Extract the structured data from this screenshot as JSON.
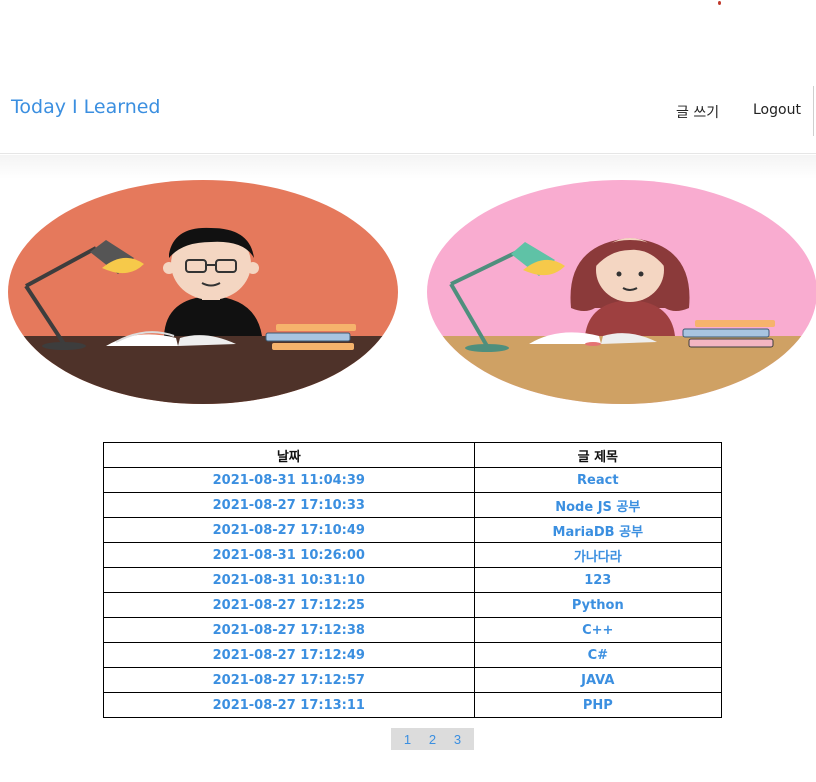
{
  "header": {
    "brand": "Today I Learned",
    "nav": {
      "write": "글 쓰기",
      "logout": "Logout"
    }
  },
  "illustrations": [
    {
      "name": "boy-studying",
      "bg_color": "#e5795c",
      "desk_color": "#4e3229"
    },
    {
      "name": "girl-studying",
      "bg_color": "#f9acd0",
      "desk_color": "#cfa164"
    }
  ],
  "table": {
    "headers": [
      "날짜",
      "글 제목"
    ],
    "rows": [
      {
        "date": "2021-08-31 11:04:39",
        "title": "React"
      },
      {
        "date": "2021-08-27 17:10:33",
        "title": "Node JS 공부"
      },
      {
        "date": "2021-08-27 17:10:49",
        "title": "MariaDB 공부"
      },
      {
        "date": "2021-08-31 10:26:00",
        "title": "가나다라"
      },
      {
        "date": "2021-08-31 10:31:10",
        "title": "123"
      },
      {
        "date": "2021-08-27 17:12:25",
        "title": "Python"
      },
      {
        "date": "2021-08-27 17:12:38",
        "title": "C++"
      },
      {
        "date": "2021-08-27 17:12:49",
        "title": "C#"
      },
      {
        "date": "2021-08-27 17:12:57",
        "title": "JAVA"
      },
      {
        "date": "2021-08-27 17:13:11",
        "title": "PHP"
      }
    ]
  },
  "pagination": [
    "1",
    "2",
    "3"
  ],
  "colors": {
    "link": "#3b8fe0",
    "pagination_bg": "#dcdcdc"
  }
}
